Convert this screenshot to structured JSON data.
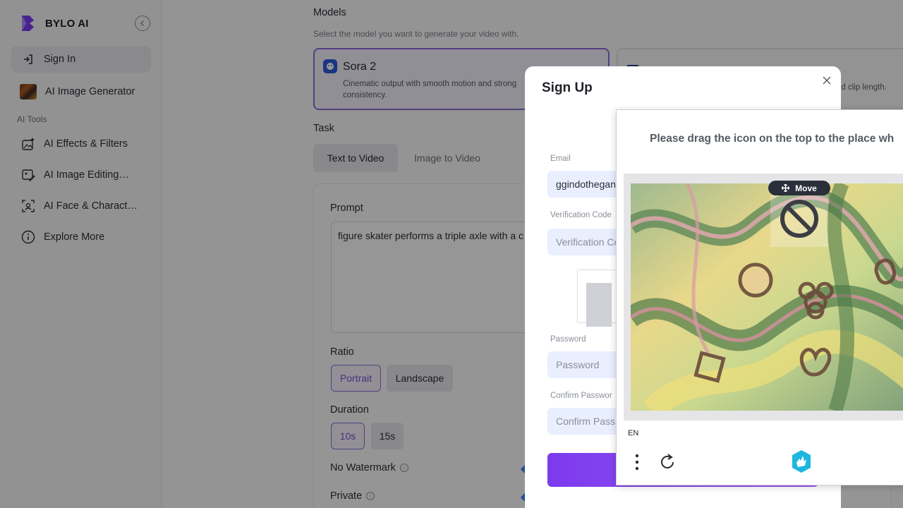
{
  "brand": {
    "name": "BYLO AI"
  },
  "sidebar": {
    "items": [
      {
        "label": "Sign In"
      },
      {
        "label": "AI Image Generator"
      }
    ],
    "section_label": "AI Tools",
    "tools": [
      {
        "label": "AI Effects & Filters"
      },
      {
        "label": "AI Image Editing…"
      },
      {
        "label": "AI Face & Charact…"
      },
      {
        "label": "Explore More"
      }
    ]
  },
  "main": {
    "models_heading": "Models",
    "models_sub": "Select the model you want to generate your video with.",
    "model_selected": {
      "title": "Sora 2",
      "desc": "Cinematic output with smooth motion and strong consistency."
    },
    "model_other": {
      "desc": "ed clip length."
    },
    "task_heading": "Task",
    "tabs": [
      {
        "label": "Text to Video"
      },
      {
        "label": "Image to Video"
      }
    ],
    "prompt_label": "Prompt",
    "prompt_value": "figure skater performs a triple axle with a c her head",
    "ratio_label": "Ratio",
    "ratio_options": [
      {
        "label": "Portrait"
      },
      {
        "label": "Landscape"
      }
    ],
    "duration_label": "Duration",
    "duration_options": [
      {
        "label": "10s"
      },
      {
        "label": "15s"
      }
    ],
    "no_watermark_label": "No Watermark",
    "private_label": "Private"
  },
  "modal": {
    "title": "Sign Up",
    "email_label": "Email",
    "email_value": "ggindothegan",
    "code_label": "Verification Code",
    "code_placeholder": "Verification Co",
    "password_label": "Password",
    "password_placeholder": "Password",
    "confirm_label": "Confirm Passwor",
    "confirm_placeholder": "Confirm Pass"
  },
  "captcha": {
    "instruction": "Please drag the icon on the top to the place wh",
    "move_label": "Move",
    "language": "EN"
  },
  "colors": {
    "accent": "#7c3aed",
    "selected_border": "#8a68d8",
    "input_bg": "#e9efff"
  }
}
